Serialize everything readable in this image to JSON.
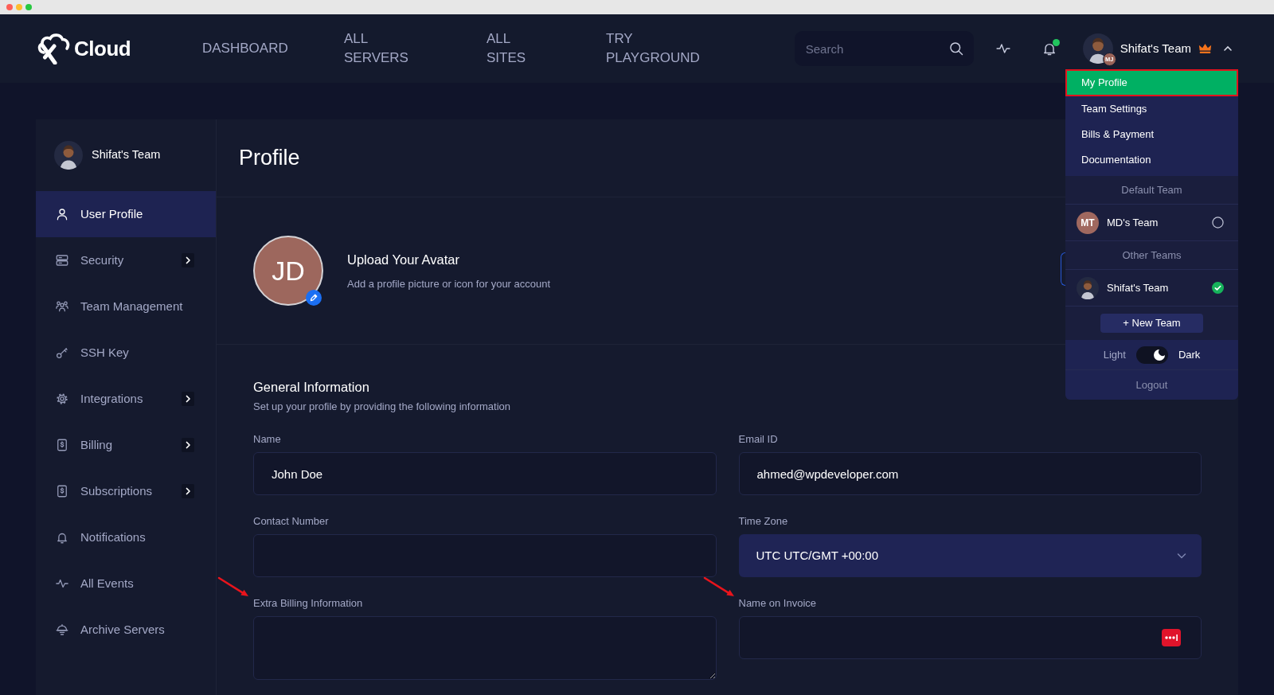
{
  "header": {
    "logo_text": "Cloud",
    "nav": [
      {
        "label": "DASHBOARD"
      },
      {
        "label": "ALL SERVERS"
      },
      {
        "label": "ALL SITES"
      },
      {
        "label": "TRY PLAYGROUND"
      }
    ],
    "search": {
      "placeholder": "Search"
    },
    "notifications": {
      "unread": true
    },
    "account": {
      "team": "Shifat's Team",
      "badge": "MJ",
      "expanded": true
    }
  },
  "account_menu": {
    "items": [
      {
        "label": "My Profile",
        "selected": true,
        "highlighted": true
      },
      {
        "label": "Team Settings",
        "selected": false,
        "highlighted": false
      },
      {
        "label": "Bills & Payment",
        "selected": false,
        "highlighted": false
      },
      {
        "label": "Documentation",
        "selected": false,
        "highlighted": false
      }
    ],
    "team_groups": [
      {
        "heading": "Default Team",
        "teams": [
          {
            "name": "MD's Team",
            "initials": "MT",
            "selected": false
          }
        ]
      },
      {
        "heading": "Other Teams",
        "teams": [
          {
            "name": "Shifat's Team",
            "selected": true
          }
        ]
      }
    ],
    "new_team_button": "+ New Team",
    "theme": {
      "light_label": "Light",
      "dark_label": "Dark",
      "dark": true
    },
    "logout": "Logout"
  },
  "sidebar": {
    "team": "Shifat's Team",
    "items": [
      {
        "label": "User Profile",
        "selected": true,
        "has_submenu": false
      },
      {
        "label": "Security",
        "selected": false,
        "has_submenu": true
      },
      {
        "label": "Team Management",
        "selected": false,
        "has_submenu": false
      },
      {
        "label": "SSH Key",
        "selected": false,
        "has_submenu": false
      },
      {
        "label": "Integrations",
        "selected": false,
        "has_submenu": true
      },
      {
        "label": "Billing",
        "selected": false,
        "has_submenu": true
      },
      {
        "label": "Subscriptions",
        "selected": false,
        "has_submenu": true
      },
      {
        "label": "Notifications",
        "selected": false,
        "has_submenu": false
      },
      {
        "label": "All Events",
        "selected": false,
        "has_submenu": false
      },
      {
        "label": "Archive Servers",
        "selected": false,
        "has_submenu": false
      }
    ]
  },
  "page": {
    "title": "Profile",
    "avatar": {
      "initials": "JD",
      "title": "Upload Your Avatar",
      "subtitle": "Add a profile picture or icon for your account"
    },
    "general_information": {
      "title": "General Information",
      "subtitle": "Set up your profile by providing the following information",
      "fields": [
        {
          "kind": "text",
          "label": "Name",
          "value": "John Doe",
          "marked": false
        },
        {
          "kind": "text",
          "label": "Email ID",
          "value": "ahmed@wpdeveloper.com",
          "marked": false
        },
        {
          "kind": "text",
          "label": "Contact Number",
          "marked": false
        },
        {
          "kind": "select",
          "label": "Time Zone",
          "value": "UTC UTC/GMT +00:00",
          "marked": false
        },
        {
          "kind": "textarea",
          "label": "Extra Billing Information",
          "marked": true
        },
        {
          "kind": "text",
          "label": "Name on Invoice",
          "marked": true,
          "autofill_icon": true
        }
      ]
    }
  }
}
